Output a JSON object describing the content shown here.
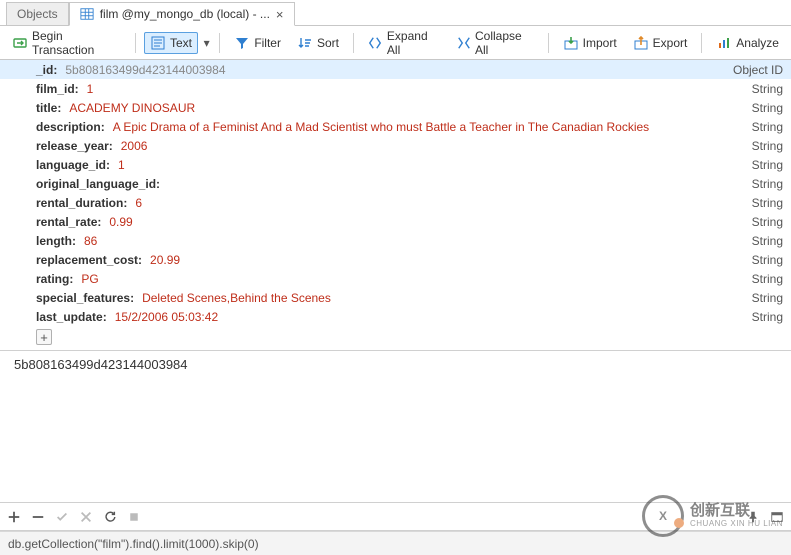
{
  "tabs": {
    "objects": "Objects",
    "active": "film @my_mongo_db (local) - ..."
  },
  "toolbar": {
    "begin_transaction": "Begin Transaction",
    "text": "Text",
    "filter": "Filter",
    "sort": "Sort",
    "expand_all": "Expand All",
    "collapse_all": "Collapse All",
    "import": "Import",
    "export": "Export",
    "analyze": "Analyze"
  },
  "fields": [
    {
      "key": "_id",
      "value": "5b808163499d423144003984",
      "type": "Object ID",
      "selected": true,
      "idval": true
    },
    {
      "key": "film_id",
      "value": "1",
      "type": "String"
    },
    {
      "key": "title",
      "value": "ACADEMY DINOSAUR",
      "type": "String"
    },
    {
      "key": "description",
      "value": "A Epic Drama of a Feminist And a Mad Scientist who must Battle a Teacher in The Canadian Rockies",
      "type": "String"
    },
    {
      "key": "release_year",
      "value": "2006",
      "type": "String"
    },
    {
      "key": "language_id",
      "value": "1",
      "type": "String"
    },
    {
      "key": "original_language_id",
      "value": "",
      "type": "String"
    },
    {
      "key": "rental_duration",
      "value": "6",
      "type": "String"
    },
    {
      "key": "rental_rate",
      "value": "0.99",
      "type": "String"
    },
    {
      "key": "length",
      "value": "86",
      "type": "String"
    },
    {
      "key": "replacement_cost",
      "value": "20.99",
      "type": "String"
    },
    {
      "key": "rating",
      "value": "PG",
      "type": "String"
    },
    {
      "key": "special_features",
      "value": "Deleted Scenes,Behind the Scenes",
      "type": "String"
    },
    {
      "key": "last_update",
      "value": "15/2/2006 05:03:42",
      "type": "String"
    }
  ],
  "recap_id": "5b808163499d423144003984",
  "query": "db.getCollection(\"film\").find().limit(1000).skip(0)",
  "watermark": {
    "logo_letter": "X",
    "cn": "创新互联",
    "en": "CHUANG XIN HU LIAN"
  }
}
